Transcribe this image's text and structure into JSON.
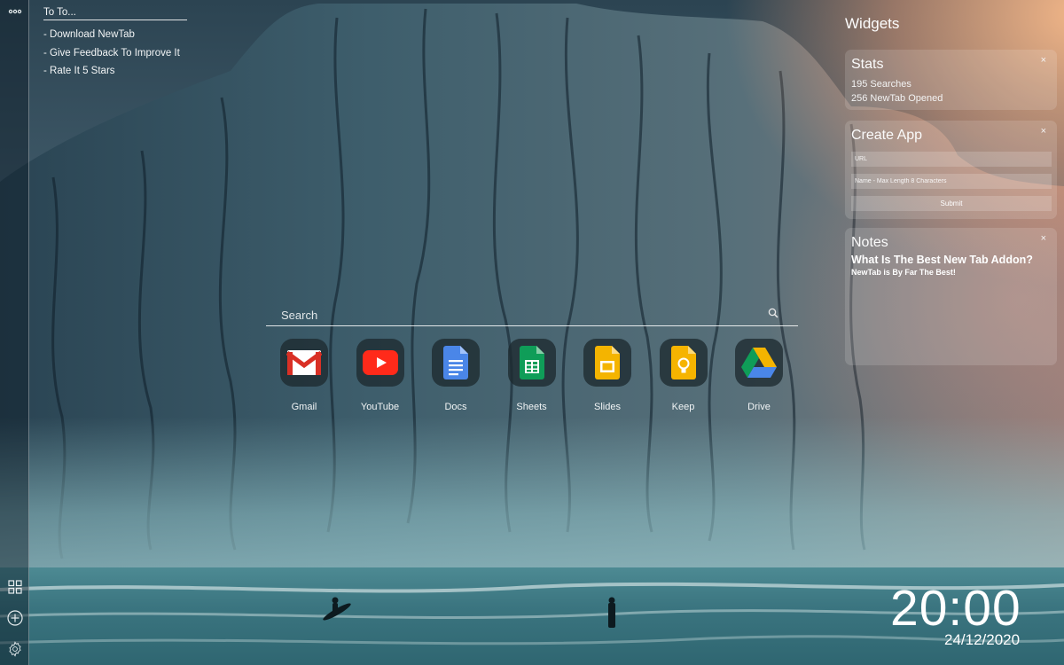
{
  "sidebar": {
    "items": [
      {
        "icon": "more-dots-icon"
      },
      {
        "icon": "apps-grid-icon"
      },
      {
        "icon": "add-circle-icon"
      },
      {
        "icon": "settings-gear-icon"
      }
    ]
  },
  "todo": {
    "title": "To To...",
    "items": [
      "- Download NewTab",
      "- Give Feedback To Improve It",
      "- Rate It 5 Stars"
    ]
  },
  "search": {
    "placeholder": "Search",
    "icon": "search-icon"
  },
  "apps": [
    {
      "label": "Gmail",
      "icon": "gmail-icon"
    },
    {
      "label": "YouTube",
      "icon": "youtube-icon"
    },
    {
      "label": "Docs",
      "icon": "docs-icon"
    },
    {
      "label": "Sheets",
      "icon": "sheets-icon"
    },
    {
      "label": "Slides",
      "icon": "slides-icon"
    },
    {
      "label": "Keep",
      "icon": "keep-icon"
    },
    {
      "label": "Drive",
      "icon": "drive-icon"
    }
  ],
  "widgets": {
    "title": "Widgets",
    "close_label": "×",
    "stats": {
      "title": "Stats",
      "searches": "195 Searches",
      "opened": "256 NewTab Opened"
    },
    "create_app": {
      "title": "Create App",
      "url_placeholder": "URL",
      "name_placeholder": "Name - Max Length 8 Characters",
      "submit_label": "Submit"
    },
    "notes": {
      "title": "Notes",
      "heading": "What Is The Best New Tab Addon?",
      "body": "NewTab is By Far The Best!"
    }
  },
  "clock": {
    "time": "20:00",
    "date": "24/12/2020"
  },
  "colors": {
    "sky_top": "#2c4452",
    "sea": "#3b7580",
    "warm_glow": "#f0a078",
    "app_tile": "#1e2a30"
  }
}
